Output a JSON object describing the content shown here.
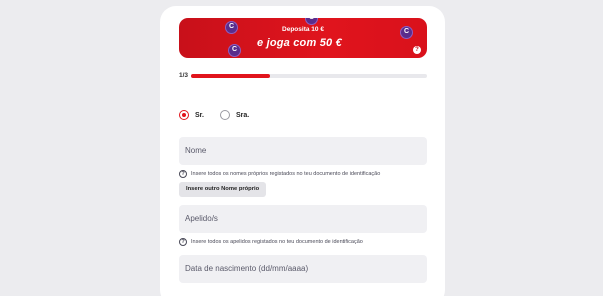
{
  "banner": {
    "deposit_text": "Deposita 10 €",
    "main_text": "e joga com 50 €",
    "coin_glyph": "C",
    "info_glyph": "?"
  },
  "progress": {
    "step_label": "1/3",
    "fraction": 0.333
  },
  "title_options": [
    {
      "label": "Sr.",
      "selected": true
    },
    {
      "label": "Sra.",
      "selected": false
    }
  ],
  "fields": {
    "first_name_placeholder": "Nome",
    "first_name_hint": "Insere todos os nomes próprios registados no teu documento de identificação",
    "add_name_button": "Insere outro Nome próprio",
    "surname_placeholder": "Apelido/s",
    "surname_hint": "Insere todos os apelidos registados no teu documento de identificação",
    "birthdate_placeholder": "Data de nascimento (dd/mm/aaaa)"
  },
  "hint_icon": "?",
  "colors": {
    "accent": "#e1141c",
    "banner": "#c8101a",
    "coin": "#5a2d8c"
  }
}
